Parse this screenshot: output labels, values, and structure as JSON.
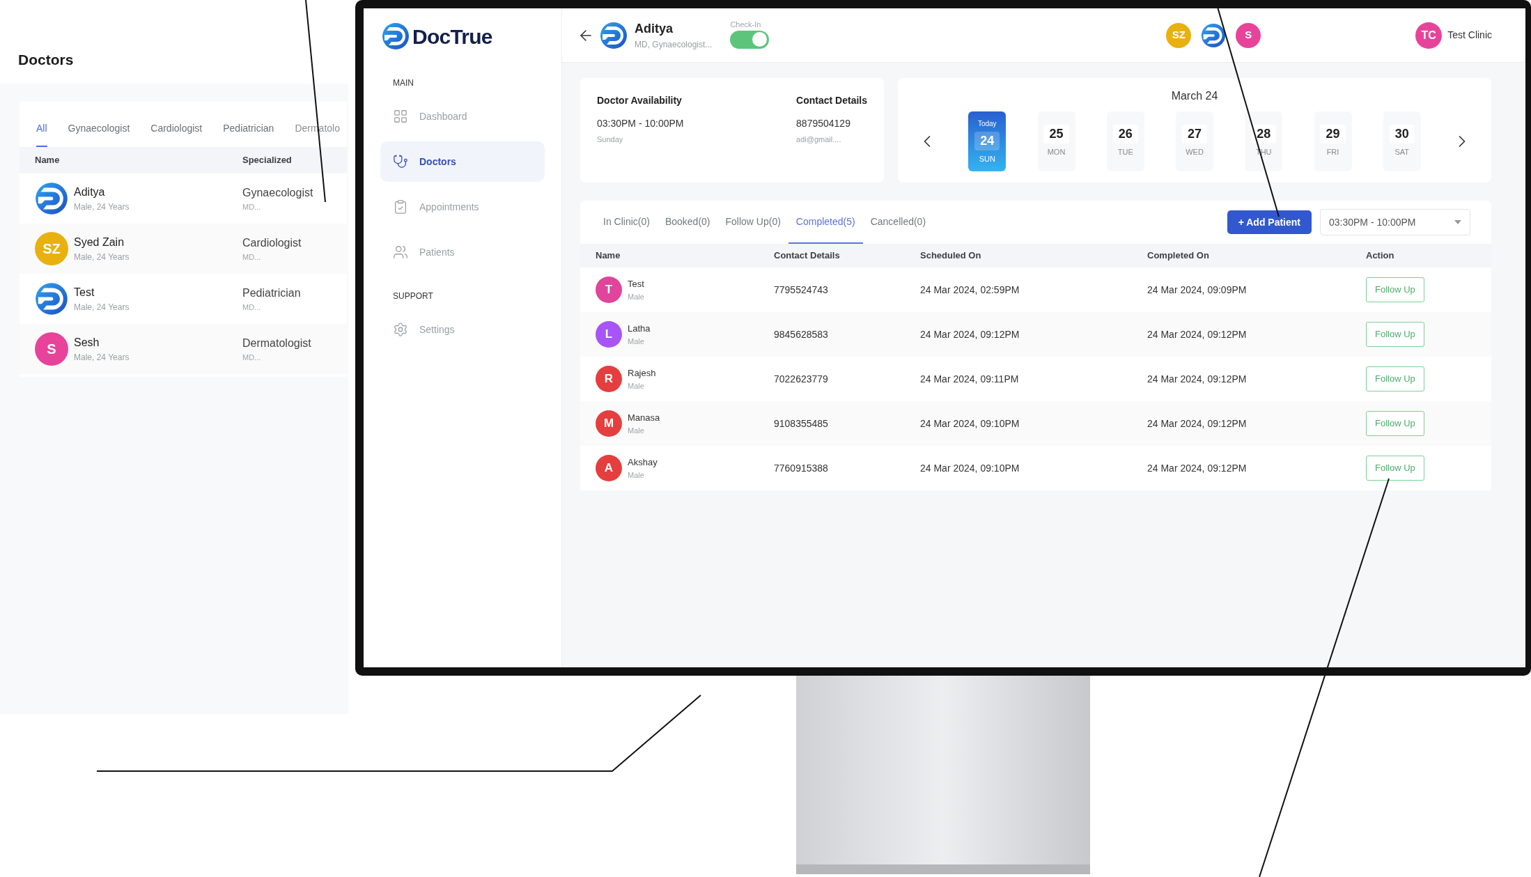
{
  "doctors_panel": {
    "title": "Doctors",
    "tabs": [
      {
        "label": "All",
        "selected": true
      },
      {
        "label": "Gynaecologist",
        "selected": false
      },
      {
        "label": "Cardiologist",
        "selected": false
      },
      {
        "label": "Pediatrician",
        "selected": false
      },
      {
        "label": "Dermatolo",
        "selected": false
      }
    ],
    "columns": [
      "Name",
      "Specialized"
    ],
    "rows": [
      {
        "avatar": {
          "kind": "logo"
        },
        "name": "Aditya",
        "info": "Male, 24 Years",
        "specialty": "Gynaecologist",
        "degree": "MD..."
      },
      {
        "avatar": {
          "kind": "initials",
          "initials": "SZ",
          "color": "#e9b10f"
        },
        "name": "Syed Zain",
        "info": "Male, 24 Years",
        "specialty": "Cardiologist",
        "degree": "MD..."
      },
      {
        "avatar": {
          "kind": "logo"
        },
        "name": "Test",
        "info": "Male, 24 Years",
        "specialty": "Pediatrician",
        "degree": "MD..."
      },
      {
        "avatar": {
          "kind": "initials",
          "initials": "S",
          "color": "#e8439a"
        },
        "name": "Sesh",
        "info": "Male, 24 Years",
        "specialty": "Dermatologist",
        "degree": "MD..."
      }
    ]
  },
  "app": {
    "brand": "DocTrue",
    "sidebar": {
      "sections": [
        {
          "heading": "MAIN",
          "items": [
            {
              "label": "Dashboard",
              "selected": false
            },
            {
              "label": "Doctors",
              "selected": true
            },
            {
              "label": "Appointments",
              "selected": false
            },
            {
              "label": "Patients",
              "selected": false
            }
          ]
        },
        {
          "heading": "SUPPORT",
          "items": [
            {
              "label": "Settings",
              "selected": false
            }
          ]
        }
      ]
    },
    "header": {
      "doctor_name": "Aditya",
      "doctor_subtitle": "MD, Gynaecologist...",
      "checkin_label": "Check-In",
      "checkin_on": true,
      "doctor_avatars": [
        {
          "kind": "initials",
          "initials": "SZ",
          "color": "#e9b10f"
        },
        {
          "kind": "logo"
        },
        {
          "kind": "initials",
          "initials": "S",
          "color": "#e8439a"
        }
      ],
      "user": {
        "initials": "TC",
        "color": "#e8439a",
        "name": "Test Clinic"
      }
    },
    "availability": {
      "title": "Doctor Availability",
      "time": "03:30PM - 10:00PM",
      "day": "Sunday"
    },
    "contact": {
      "title": "Contact Details",
      "phone": "8879504129",
      "email": "adi@gmail...."
    },
    "calendar": {
      "month": "March 24",
      "days": [
        {
          "badge": "Today",
          "date": "24",
          "day": "SUN",
          "selected": true
        },
        {
          "date": "25",
          "day": "MON",
          "selected": false
        },
        {
          "date": "26",
          "day": "TUE",
          "selected": false
        },
        {
          "date": "27",
          "day": "WED",
          "selected": false
        },
        {
          "date": "28",
          "day": "THU",
          "selected": false
        },
        {
          "date": "29",
          "day": "FRI",
          "selected": false
        },
        {
          "date": "30",
          "day": "SAT",
          "selected": false
        }
      ]
    },
    "tabs": [
      {
        "label": "In Clinic(0)",
        "selected": false
      },
      {
        "label": "Booked(0)",
        "selected": false
      },
      {
        "label": "Follow Up(0)",
        "selected": false
      },
      {
        "label": "Completed(5)",
        "selected": true
      },
      {
        "label": "Cancelled(0)",
        "selected": false
      }
    ],
    "add_button": "+ Add Patient",
    "slot_select": {
      "value": "03:30PM - 10:00PM"
    },
    "table": {
      "columns": [
        "Name",
        "Contact Details",
        "Scheduled On",
        "Completed On",
        "Action"
      ],
      "rows": [
        {
          "initial": "T",
          "color": "#e0449b",
          "name": "Test",
          "gender": "Male",
          "contact": "7795524743",
          "scheduled": "24 Mar 2024, 02:59PM",
          "completed": "24 Mar 2024, 09:09PM",
          "action": "Follow Up"
        },
        {
          "initial": "L",
          "color": "#a855f7",
          "name": "Latha",
          "gender": "Male",
          "contact": "9845628583",
          "scheduled": "24 Mar 2024, 09:12PM",
          "completed": "24 Mar 2024, 09:12PM",
          "action": "Follow Up"
        },
        {
          "initial": "R",
          "color": "#e53e3e",
          "name": "Rajesh",
          "gender": "Male",
          "contact": "7022623779",
          "scheduled": "24 Mar 2024, 09:11PM",
          "completed": "24 Mar 2024, 09:12PM",
          "action": "Follow Up"
        },
        {
          "initial": "M",
          "color": "#e53e3e",
          "name": "Manasa",
          "gender": "Male",
          "contact": "9108355485",
          "scheduled": "24 Mar 2024, 09:10PM",
          "completed": "24 Mar 2024, 09:12PM",
          "action": "Follow Up"
        },
        {
          "initial": "A",
          "color": "#e53e3e",
          "name": "Akshay",
          "gender": "Male",
          "contact": "7760915388",
          "scheduled": "24 Mar 2024, 09:10PM",
          "completed": "24 Mar 2024, 09:12PM",
          "action": "Follow Up"
        }
      ]
    }
  }
}
